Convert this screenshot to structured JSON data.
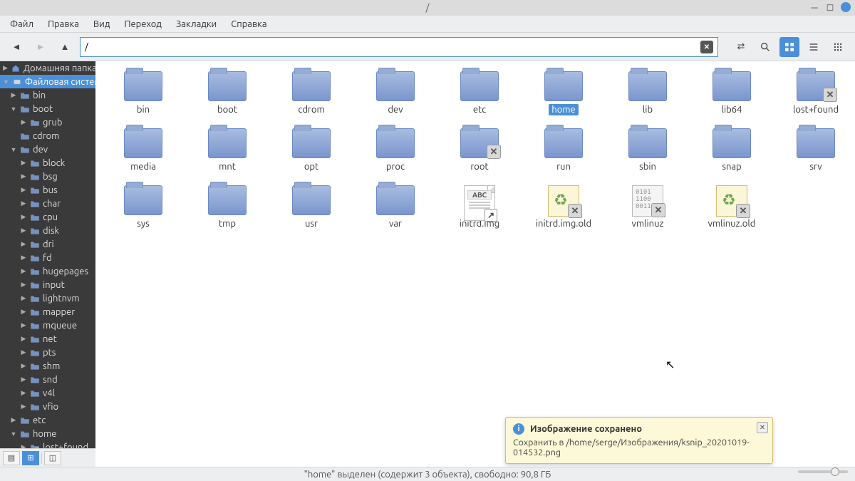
{
  "titlebar": {
    "title": "/"
  },
  "menu": {
    "file": "Файл",
    "edit": "Правка",
    "view": "Вид",
    "go": "Переход",
    "bookmarks": "Закладки",
    "help": "Справка"
  },
  "path": {
    "value": "/",
    "clear_glyph": "⌫"
  },
  "sidebar": {
    "roots": [
      {
        "label": "Домашняя папка",
        "icon": "home",
        "expanded": false,
        "selected": false
      },
      {
        "label": "Файловая систем",
        "icon": "drive",
        "expanded": true,
        "selected": true
      }
    ],
    "tree": [
      {
        "label": "bin",
        "depth": 1,
        "expanded": false
      },
      {
        "label": "boot",
        "depth": 1,
        "expanded": true
      },
      {
        "label": "grub",
        "depth": 2,
        "expanded": false
      },
      {
        "label": "cdrom",
        "depth": 1,
        "expanded": false,
        "noarrow": true
      },
      {
        "label": "dev",
        "depth": 1,
        "expanded": true
      },
      {
        "label": "block",
        "depth": 2,
        "expanded": false
      },
      {
        "label": "bsg",
        "depth": 2,
        "expanded": false
      },
      {
        "label": "bus",
        "depth": 2,
        "expanded": false
      },
      {
        "label": "char",
        "depth": 2,
        "expanded": false
      },
      {
        "label": "cpu",
        "depth": 2,
        "expanded": false
      },
      {
        "label": "disk",
        "depth": 2,
        "expanded": false
      },
      {
        "label": "dri",
        "depth": 2,
        "expanded": false
      },
      {
        "label": "fd",
        "depth": 2,
        "expanded": false
      },
      {
        "label": "hugepages",
        "depth": 2,
        "expanded": false
      },
      {
        "label": "input",
        "depth": 2,
        "expanded": false
      },
      {
        "label": "lightnvm",
        "depth": 2,
        "expanded": false
      },
      {
        "label": "mapper",
        "depth": 2,
        "expanded": false
      },
      {
        "label": "mqueue",
        "depth": 2,
        "expanded": false
      },
      {
        "label": "net",
        "depth": 2,
        "expanded": false
      },
      {
        "label": "pts",
        "depth": 2,
        "expanded": false
      },
      {
        "label": "shm",
        "depth": 2,
        "expanded": false
      },
      {
        "label": "snd",
        "depth": 2,
        "expanded": false
      },
      {
        "label": "v4l",
        "depth": 2,
        "expanded": false
      },
      {
        "label": "vfio",
        "depth": 2,
        "expanded": false
      },
      {
        "label": "etc",
        "depth": 1,
        "expanded": false
      },
      {
        "label": "home",
        "depth": 1,
        "expanded": true
      },
      {
        "label": "lost+found",
        "depth": 2,
        "expanded": false,
        "locked": true
      }
    ]
  },
  "items": [
    {
      "name": "bin",
      "type": "folder"
    },
    {
      "name": "boot",
      "type": "folder"
    },
    {
      "name": "cdrom",
      "type": "folder"
    },
    {
      "name": "dev",
      "type": "folder"
    },
    {
      "name": "etc",
      "type": "folder"
    },
    {
      "name": "home",
      "type": "folder",
      "selected": true
    },
    {
      "name": "lib",
      "type": "folder"
    },
    {
      "name": "lib64",
      "type": "folder"
    },
    {
      "name": "lost+found",
      "type": "folder",
      "locked": true
    },
    {
      "name": "media",
      "type": "folder"
    },
    {
      "name": "mnt",
      "type": "folder"
    },
    {
      "name": "opt",
      "type": "folder"
    },
    {
      "name": "proc",
      "type": "folder"
    },
    {
      "name": "root",
      "type": "folder",
      "locked": true
    },
    {
      "name": "run",
      "type": "folder"
    },
    {
      "name": "sbin",
      "type": "folder"
    },
    {
      "name": "snap",
      "type": "folder"
    },
    {
      "name": "srv",
      "type": "folder"
    },
    {
      "name": "sys",
      "type": "folder"
    },
    {
      "name": "tmp",
      "type": "folder"
    },
    {
      "name": "usr",
      "type": "folder"
    },
    {
      "name": "var",
      "type": "folder"
    },
    {
      "name": "initrd.img",
      "type": "textlink"
    },
    {
      "name": "initrd.img.old",
      "type": "recyclelink",
      "locked": true
    },
    {
      "name": "vmlinuz",
      "type": "binlink",
      "locked": true
    },
    {
      "name": "vmlinuz.old",
      "type": "recyclelink",
      "locked": true
    }
  ],
  "status": {
    "text": "\"home\" выделен (содержит 3 объекта), свободно: 90,8 ГБ"
  },
  "bottombar": {
    "b1": "≡",
    "b2": "⊡",
    "b3": "☐"
  },
  "notification": {
    "title": "Изображение сохранено",
    "body": "Сохранить в /home/serge/Изображения/ksnip_20201019-014532.png"
  },
  "icons": {
    "abc": "ABC"
  }
}
